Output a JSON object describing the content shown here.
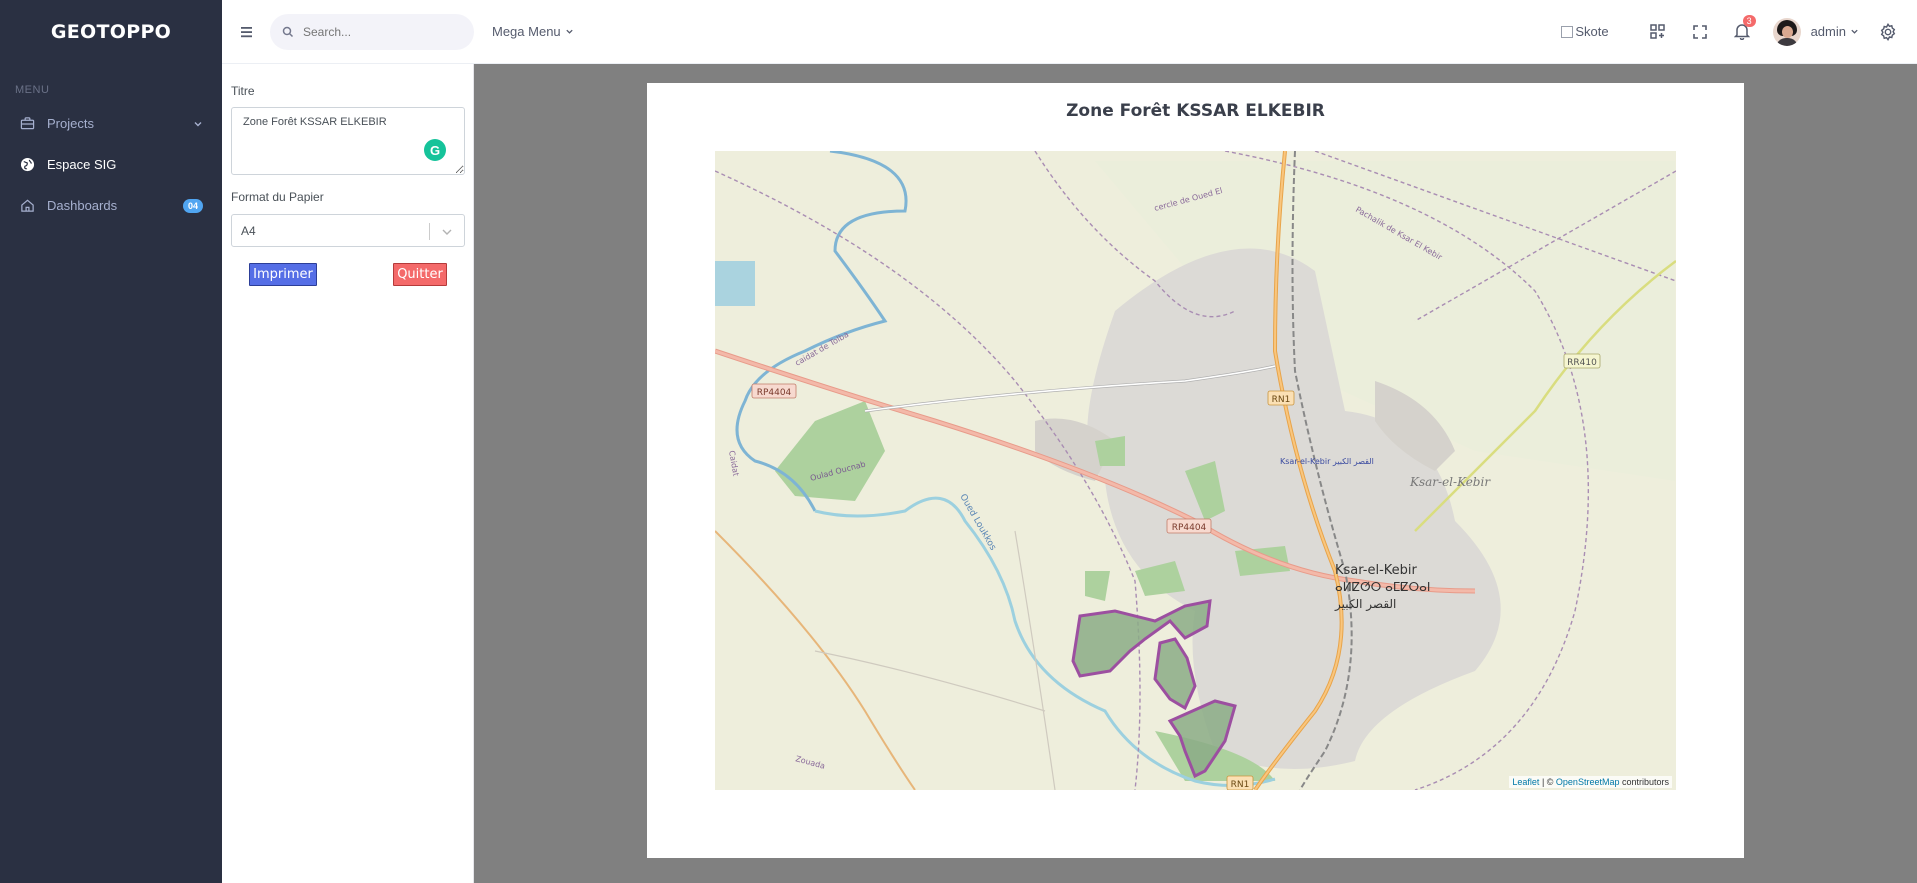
{
  "sidebar": {
    "brand": "GEOTOPPO",
    "menu_title": "MENU",
    "items": [
      {
        "label": "Projects",
        "icon": "briefcase-icon"
      },
      {
        "label": "Espace SIG",
        "icon": "globe-icon"
      },
      {
        "label": "Dashboards",
        "icon": "home-icon",
        "badge": "04"
      }
    ]
  },
  "topbar": {
    "search_placeholder": "Search...",
    "mega_menu": "Mega Menu",
    "brand_alt": "Skote",
    "notification_count": "3",
    "user_name": "admin"
  },
  "form": {
    "titre_label": "Titre",
    "titre_value": "Zone Forêt KSSAR ELKEBIR",
    "grammarly": "G",
    "format_label": "Format du Papier",
    "format_value": "A4",
    "print_label": "Imprimer",
    "quit_label": "Quitter"
  },
  "preview": {
    "title": "Zone Forêt KSSAR ELKEBIR",
    "map_labels": {
      "rp4404_a": "RP4404",
      "rp4404_b": "RP4404",
      "rr410": "RR410",
      "rn1_top": "RN1",
      "rn1_bottom": "RN1",
      "city_1": "Ksar-el-Kebir",
      "city_2": "ⴰⵍⵇⵚⵔ ⴰⵎⵇⵔⴰⵏ",
      "city_3": "القصر الكبير",
      "city_small": "Ksar-el-Kebir القصر الكبير",
      "district": "Ksar-el-Kebir",
      "river_1": "Oued Loukkos",
      "river_2": "Oulad Oucnab",
      "road_1": "caidat de Tolba",
      "road_2": "Zouada",
      "road_3": "Pachalik de Ksar El Kebir",
      "road_4": "cercle de Oued El",
      "road_5": "Caidat"
    },
    "attribution": {
      "leaflet": "Leaflet",
      "separator": " | © ",
      "osm": "OpenStreetMap",
      "suffix": " contributors"
    }
  }
}
